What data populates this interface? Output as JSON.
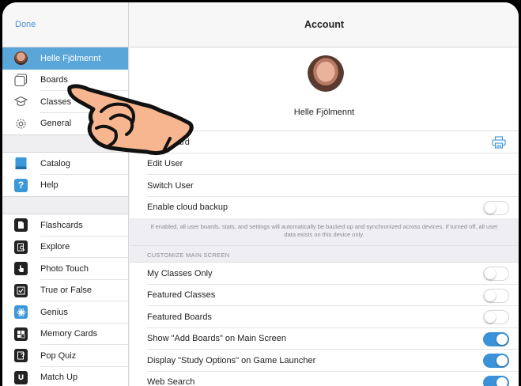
{
  "sidebar": {
    "done_label": "Done",
    "user": {
      "name": "Helle Fjölmennt",
      "icon": "avatar"
    },
    "group1": [
      {
        "label": "Boards",
        "icon": "boards-icon"
      },
      {
        "label": "Classes",
        "icon": "classes-icon"
      },
      {
        "label": "General",
        "icon": "gear-icon"
      }
    ],
    "group2": [
      {
        "label": "Catalog",
        "icon": "catalog-icon"
      },
      {
        "label": "Help",
        "icon": "help-icon",
        "glyph": "?"
      }
    ],
    "games": [
      {
        "label": "Flashcards",
        "icon": "flashcards-icon"
      },
      {
        "label": "Explore",
        "icon": "explore-icon"
      },
      {
        "label": "Photo Touch",
        "icon": "photo-touch-icon"
      },
      {
        "label": "True or False",
        "icon": "true-false-icon"
      },
      {
        "label": "Genius",
        "icon": "genius-icon"
      },
      {
        "label": "Memory Cards",
        "icon": "memory-cards-icon"
      },
      {
        "label": "Pop Quiz",
        "icon": "pop-quiz-icon"
      },
      {
        "label": "Match Up",
        "icon": "match-up-icon"
      }
    ]
  },
  "main": {
    "title": "Account",
    "profile_name": "Helle Fjölmennt",
    "rows": [
      {
        "label": "Login Card",
        "accessory": "printer-icon"
      },
      {
        "label": "Edit User"
      },
      {
        "label": "Switch User"
      },
      {
        "label": "Enable cloud backup",
        "toggle": false
      }
    ],
    "cloud_note": "If enabled, all user boards, stats, and settings will automatically be backed up and synchronized across devices. If turned off, all user data exists on this device only.",
    "customize_header": "CUSTOMIZE MAIN SCREEN",
    "customize_rows": [
      {
        "label": "My Classes Only",
        "toggle": false
      },
      {
        "label": "Featured Classes",
        "toggle": false
      },
      {
        "label": "Featured Boards",
        "toggle": false
      },
      {
        "label": "Show \"Add Boards\" on Main Screen",
        "toggle": true
      },
      {
        "label": "Display \"Study Options\" on Game Launcher",
        "toggle": true
      },
      {
        "label": "Web Search",
        "toggle": true
      }
    ]
  },
  "colors": {
    "accent": "#3c92d8",
    "selected": "#5aa6d9",
    "hand_fill": "#f7b690"
  }
}
